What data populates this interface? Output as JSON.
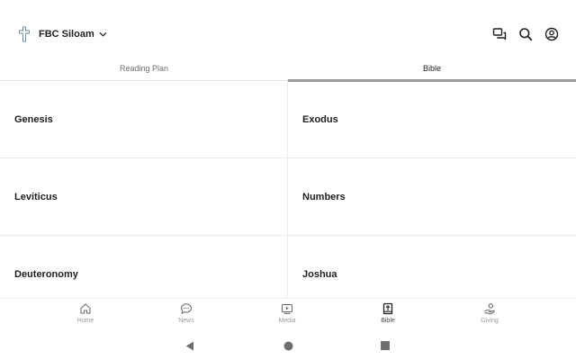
{
  "header": {
    "church_name": "FBC Siloam",
    "icons": {
      "church_logo": "cross-icon",
      "dropdown": "chevron-down-icon",
      "chat": "chat-icon",
      "search": "search-icon",
      "account": "account-icon"
    }
  },
  "tabs": [
    {
      "label": "Reading Plan",
      "active": false
    },
    {
      "label": "Bible",
      "active": true
    }
  ],
  "books": [
    {
      "name": "Genesis"
    },
    {
      "name": "Exodus"
    },
    {
      "name": "Leviticus"
    },
    {
      "name": "Numbers"
    },
    {
      "name": "Deuteronomy"
    },
    {
      "name": "Joshua"
    }
  ],
  "bottom_nav": [
    {
      "label": "Home",
      "icon": "home-icon",
      "active": false
    },
    {
      "label": "News",
      "icon": "news-icon",
      "active": false
    },
    {
      "label": "Media",
      "icon": "media-icon",
      "active": false
    },
    {
      "label": "Bible",
      "icon": "bible-icon",
      "active": true
    },
    {
      "label": "Giving",
      "icon": "giving-icon",
      "active": false
    }
  ],
  "system_nav": {
    "back": "back-icon",
    "home": "home-circle-icon",
    "recents": "recents-icon"
  },
  "colors": {
    "text_primary": "#1f1f1f",
    "text_secondary": "#6e6e6e",
    "nav_inactive": "#9a9a9a",
    "tab_indicator": "#9a9a9a",
    "divider": "#ececec",
    "logo_blue": "#6d8ea6"
  }
}
